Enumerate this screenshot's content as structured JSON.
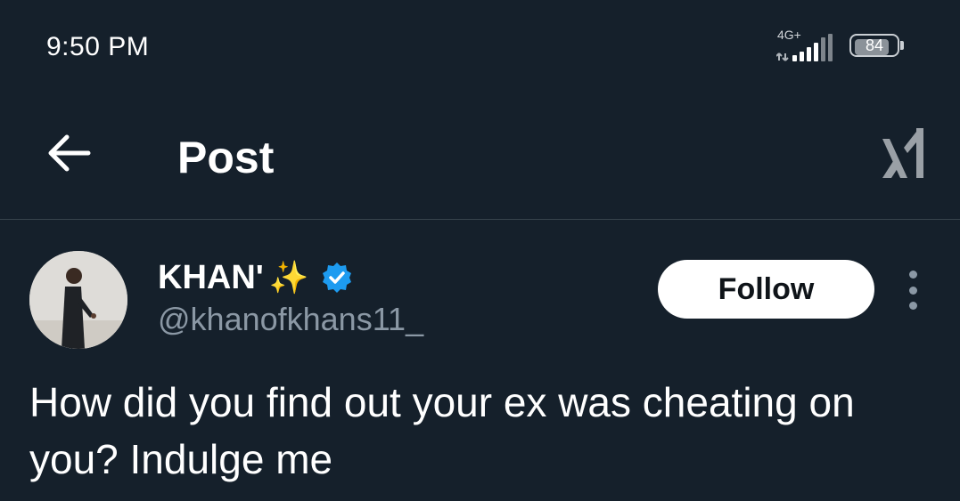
{
  "status_bar": {
    "time": "9:50 PM",
    "network": "4G+",
    "battery_level": "84",
    "icons": [
      "signal-icon",
      "battery-icon"
    ]
  },
  "header": {
    "title": "Post",
    "back_icon": "arrow-left-icon",
    "brand_icon": "grok-icon"
  },
  "post": {
    "author": {
      "display_name": "KHAN'",
      "emoji": "✨",
      "handle": "@khanofkhans11_",
      "verified": true
    },
    "follow_label": "Follow",
    "text": "How did you find out your ex was cheating on you? Indulge me"
  },
  "colors": {
    "background": "#15202b",
    "divider": "#38444d",
    "secondary_text": "#8b98a5",
    "verified_blue": "#1d9bf0"
  }
}
